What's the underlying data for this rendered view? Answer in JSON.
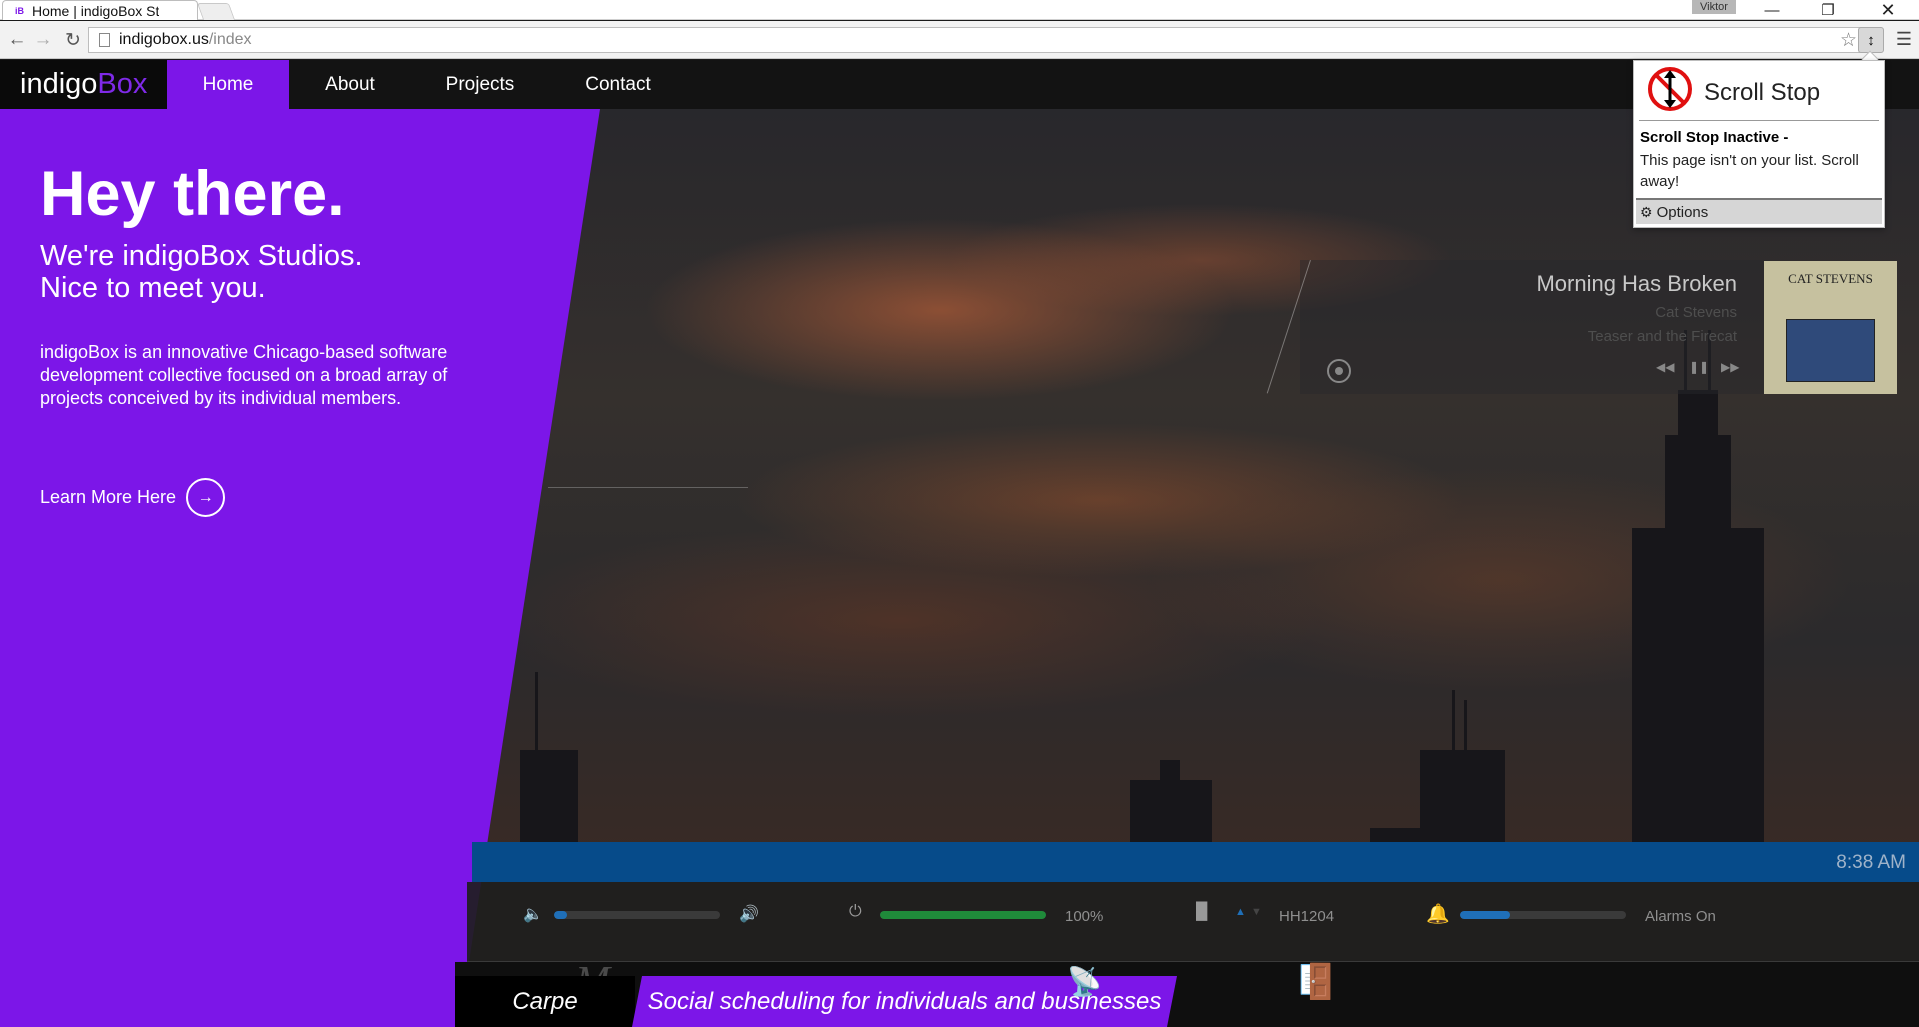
{
  "browser": {
    "tab_title": "Home | indigoBox St",
    "tab_favicon": "iB",
    "profile_name": "Viktor",
    "url_host": "indigobox.us",
    "url_path": "/index",
    "icons": {
      "back": "back-arrow-icon",
      "forward": "forward-arrow-icon",
      "reload": "reload-icon",
      "star": "bookmark-star-icon",
      "menu": "hamburger-menu-icon"
    }
  },
  "site": {
    "logo_part1": "indigo",
    "logo_part2": "Box",
    "nav": [
      {
        "label": "Home",
        "active": true
      },
      {
        "label": "About"
      },
      {
        "label": "Projects"
      },
      {
        "label": "Contact"
      }
    ],
    "hero": {
      "title": "Hey there.",
      "subtitle_line1": "We're indigoBox Studios.",
      "subtitle_line2": "Nice to meet you.",
      "description": "indigoBox is an innovative Chicago-based software development collective focused on a broad array of projects conceived by its individual members.",
      "cta": "Learn More Here"
    },
    "brand_color": "#7c16e8"
  },
  "music": {
    "title": "Morning Has Broken",
    "artist": "Cat Stevens",
    "album": "Teaser and the Firecat",
    "album_cover_text": "CAT STEVENS"
  },
  "status": {
    "time": "8:38 AM",
    "volume_level": 0.08,
    "battery_level": 1.0,
    "battery_text": "100%",
    "network_name": "HH1204",
    "alarm_level": 0.3,
    "alarm_text": "Alarms On"
  },
  "projects": {
    "current_name": "Carpe",
    "tagline": "Social scheduling for individuals and businesses"
  },
  "popup": {
    "title": "Scroll Stop",
    "status": "Scroll Stop Inactive -",
    "message": "This page isn't on your list. Scroll away!",
    "options_label": "Options"
  }
}
